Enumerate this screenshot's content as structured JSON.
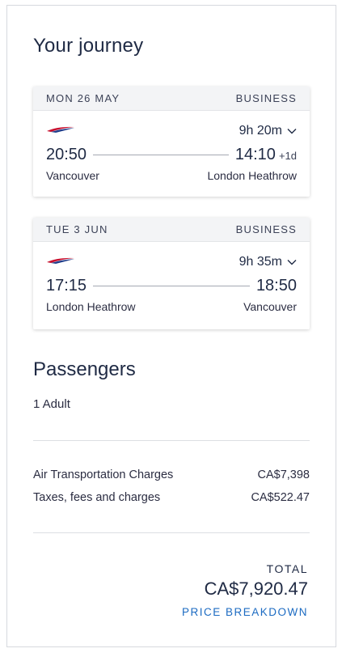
{
  "journey": {
    "title": "Your journey",
    "flights": [
      {
        "date": "MON 26 MAY",
        "cabin": "BUSINESS",
        "duration": "9h 20m",
        "depart_time": "20:50",
        "arrive_time": "14:10",
        "day_offset": "+1d",
        "origin": "Vancouver",
        "destination": "London Heathrow",
        "airline_icon": "british-airways-speedmarque"
      },
      {
        "date": "TUE 3 JUN",
        "cabin": "BUSINESS",
        "duration": "9h 35m",
        "depart_time": "17:15",
        "arrive_time": "18:50",
        "origin": "London Heathrow",
        "destination": "Vancouver",
        "airline_icon": "british-airways-speedmarque"
      }
    ]
  },
  "passengers": {
    "title": "Passengers",
    "count": "1 Adult"
  },
  "charges": [
    {
      "label": "Air Transportation Charges",
      "amount": "CA$7,398"
    },
    {
      "label": "Taxes, fees and charges",
      "amount": "CA$522.47"
    }
  ],
  "total": {
    "label": "TOTAL",
    "amount": "CA$7,920.47",
    "breakdown_link": "PRICE BREAKDOWN"
  },
  "colors": {
    "logo_red": "#c8102e",
    "logo_blue": "#1f3c8a",
    "link_blue": "#1c6bc2"
  }
}
